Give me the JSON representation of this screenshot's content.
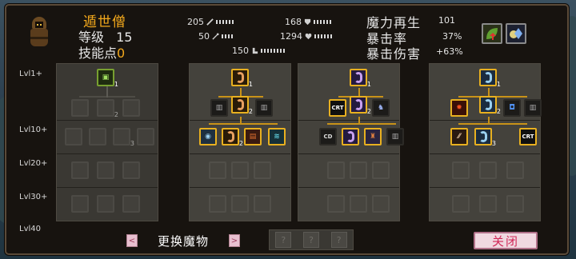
{
  "character": {
    "name": "遁世僧",
    "level_label": "等级",
    "level_value": "15",
    "skill_points_label": "技能点",
    "skill_points_value": "0"
  },
  "stats": [
    {
      "value": "205",
      "icon": "sword-icon"
    },
    {
      "value": "168",
      "icon": "shield-icon"
    },
    {
      "value": "50",
      "icon": "wand-icon"
    },
    {
      "value": "1294",
      "icon": "heart-icon"
    },
    {
      "value": "150",
      "icon": "boot-icon"
    }
  ],
  "right_stats": [
    {
      "label": "魔力再生",
      "value": "101"
    },
    {
      "label": "暴击率",
      "value": "37%"
    },
    {
      "label": "暴击伤害",
      "value": "+63%"
    }
  ],
  "level_rows": [
    "Lvl1+",
    "Lvl10+",
    "Lvl20+",
    "Lvl30+",
    "Lvl40"
  ],
  "trees": [
    {
      "root_level": "1",
      "nodes": [
        {
          "label": "",
          "level": "",
          "state": "dim"
        },
        {
          "label": "",
          "level": "2",
          "state": "dim"
        },
        {
          "label": "",
          "level": "3",
          "state": "dim"
        }
      ]
    },
    {
      "root_level": "1",
      "nodes": [
        {
          "label": "",
          "level": "2",
          "state": "on"
        },
        {
          "label": "",
          "level": "2",
          "state": "on"
        },
        {
          "label": "",
          "level": "",
          "state": "on"
        }
      ]
    },
    {
      "root_level": "1",
      "nodes": [
        {
          "label": "CRT",
          "level": "",
          "state": "on"
        },
        {
          "label": "",
          "level": "2",
          "state": "on"
        },
        {
          "label": "CD",
          "level": "",
          "state": "on"
        }
      ]
    },
    {
      "root_level": "1",
      "nodes": [
        {
          "label": "",
          "level": "2",
          "state": "on"
        },
        {
          "label": "",
          "level": "3",
          "state": "on"
        },
        {
          "label": "CRT",
          "level": "",
          "state": "on"
        }
      ]
    }
  ],
  "bottom": {
    "change_label": "更换魔物",
    "prev_arrow": "<",
    "next_arrow": ">",
    "slots": [
      "?",
      "?",
      "?"
    ],
    "close_label": "关闭"
  }
}
